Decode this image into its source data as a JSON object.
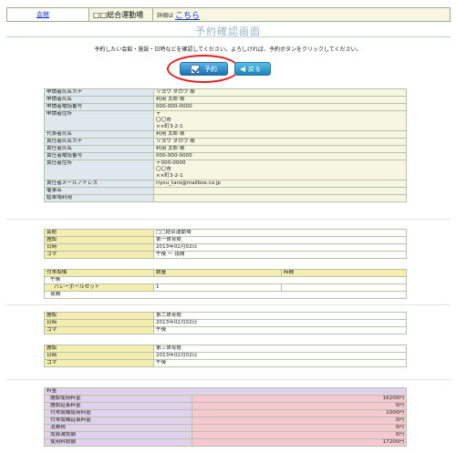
{
  "topbar": {
    "venue_link": "会館",
    "venue_name": "□□総合運動場",
    "detail_label": "詳細は",
    "detail_link": "こちら"
  },
  "page_title": "予約確認画面",
  "instruction": "予約したい会館・施設・日時などを確認してください。よろしければ、予約ボタンをクリックしてください。",
  "buttons": {
    "reserve": "予約",
    "back": "戻る"
  },
  "applicant": {
    "rows": [
      {
        "label": "申請者氏名カナ",
        "value": "リヨウ タロウ 様"
      },
      {
        "label": "申請者氏名",
        "value": "利用 太郎 様"
      },
      {
        "label": "申請者電話番号",
        "value": "000-000-0000"
      },
      {
        "label": "申請者住所",
        "lines": [
          "〒",
          "〇〇市",
          "××町3-2-1"
        ]
      },
      {
        "label": "代表者氏名",
        "value": "利用 太郎 様"
      },
      {
        "label": "責任者氏名カナ",
        "value": "リヨウ タロウ 様"
      },
      {
        "label": "責任者氏名",
        "value": "利用 太郎 様"
      },
      {
        "label": "責任者電話番号",
        "value": "000-000-0000"
      },
      {
        "label": "責任者住所",
        "lines": [
          "〒000-0000",
          "〇〇市",
          "××町3-2-1"
        ]
      },
      {
        "label": "責任者メールアドレス",
        "value": "riyou_taro@mailbox.co.jp"
      },
      {
        "label": "催事名",
        "value": ""
      },
      {
        "label": "駐車場利用",
        "value": ""
      }
    ]
  },
  "venue_block": {
    "rows": [
      {
        "label": "会館",
        "value": "□□総合運動場"
      },
      {
        "label": "施設",
        "value": "第一体育館"
      },
      {
        "label": "日時",
        "value": "2013年02月02日"
      },
      {
        "label": "コマ",
        "value": "午後 〜 夜間"
      }
    ]
  },
  "equipment": {
    "headers": {
      "name": "付帯設備",
      "qty": "数量",
      "time": "時間"
    },
    "group1": "午後",
    "item": {
      "name": "バレーボールセット",
      "qty": "1"
    },
    "group2": "夜間"
  },
  "facility2": {
    "rows": [
      {
        "label": "施設",
        "value": "第二体育館"
      },
      {
        "label": "日時",
        "value": "2013年02月02日"
      },
      {
        "label": "コマ",
        "value": "午後"
      }
    ]
  },
  "facility3": {
    "rows": [
      {
        "label": "施設",
        "value": "第三体育館"
      },
      {
        "label": "日時",
        "value": "2013年02月02日"
      },
      {
        "label": "コマ",
        "value": "午後"
      }
    ]
  },
  "fees": {
    "header": "料金",
    "rows": [
      {
        "label": "施設使用料金",
        "value": "16200円"
      },
      {
        "label": "施設延長料金",
        "value": "0円"
      },
      {
        "label": "付帯設備使用料金",
        "value": "1000円"
      },
      {
        "label": "付帯設備延長料金",
        "value": "0円"
      },
      {
        "label": "消費税",
        "value": "0円"
      },
      {
        "label": "加算減免額",
        "value": "0円"
      },
      {
        "label": "使用料総額",
        "value": "17200円"
      }
    ]
  },
  "colors": {
    "highlight": "#e62020",
    "button": "#1b6fb0",
    "link": "#1a37c8"
  }
}
